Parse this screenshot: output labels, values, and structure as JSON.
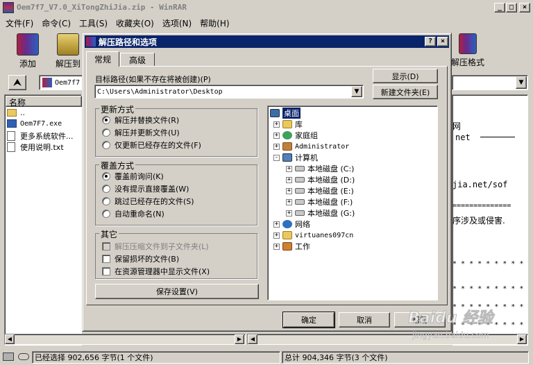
{
  "window": {
    "title": "Oem7f7_V7.0_XiTongZhiJia.zip - WinRAR",
    "min": "_",
    "max": "□",
    "close": "×"
  },
  "menu": [
    "文件(F)",
    "命令(C)",
    "工具(S)",
    "收藏夹(O)",
    "选项(N)",
    "帮助(H)"
  ],
  "toolbar": {
    "add": "添加",
    "extract_to": "解压到",
    "extract_format": "解压格式"
  },
  "address": {
    "path": "Oem7f7"
  },
  "filelist": {
    "header_name": "名称",
    "items": [
      "..",
      "Oem7F7.exe",
      "更多系统软件...",
      "使用说明.txt"
    ]
  },
  "bg_text": {
    "lines": [
      "网",
      "net",
      "jia.net/sof",
      "==============",
      "序涉及或侵害.",
      "* * * * * * * * *",
      "* * * * * * * * *",
      "* * * * * * * * *",
      "* * * * * * * * *"
    ]
  },
  "dialog": {
    "title": "解压路径和选项",
    "help_btn": "?",
    "close_btn": "×",
    "tabs": [
      "常规",
      "高级"
    ],
    "dest_label": "目标路径(如果不存在将被创建)(P)",
    "dest_value": "C:\\Users\\Administrator\\Desktop",
    "show_btn": "显示(D)",
    "new_folder_btn": "新建文件夹(E)",
    "update_group": {
      "title": "更新方式",
      "options": [
        "解压并替换文件(R)",
        "解压并更新文件(U)",
        "仅更新已经存在的文件(F)"
      ],
      "selected": 0
    },
    "overwrite_group": {
      "title": "覆盖方式",
      "options": [
        "覆盖前询问(K)",
        "没有提示直接覆盖(W)",
        "跳过已经存在的文件(S)",
        "自动重命名(N)"
      ],
      "selected": 0
    },
    "misc_group": {
      "title": "其它",
      "options": [
        "解压压缩文件到子文件夹(L)",
        "保留损坏的文件(B)",
        "在资源管理器中显示文件(X)"
      ],
      "disabled_index": 0
    },
    "save_btn": "保存设置(V)",
    "tree": [
      {
        "label": "桌面",
        "level": 0,
        "expander": "",
        "selected": true
      },
      {
        "label": "库",
        "level": 1,
        "expander": "+"
      },
      {
        "label": "家庭组",
        "level": 1,
        "expander": "+"
      },
      {
        "label": "Administrator",
        "level": 1,
        "expander": "+"
      },
      {
        "label": "计算机",
        "level": 1,
        "expander": "-"
      },
      {
        "label": "本地磁盘 (C:)",
        "level": 2,
        "expander": "+"
      },
      {
        "label": "本地磁盘 (D:)",
        "level": 2,
        "expander": "+"
      },
      {
        "label": "本地磁盘 (E:)",
        "level": 2,
        "expander": "+"
      },
      {
        "label": "本地磁盘 (F:)",
        "level": 2,
        "expander": "+"
      },
      {
        "label": "本地磁盘 (G:)",
        "level": 2,
        "expander": "+"
      },
      {
        "label": "网络",
        "level": 1,
        "expander": "+"
      },
      {
        "label": "virtuanes097cn",
        "level": 1,
        "expander": "+"
      },
      {
        "label": "工作",
        "level": 1,
        "expander": "+"
      }
    ],
    "ok_btn": "确定",
    "cancel_btn": "取消",
    "help_label": "帮助"
  },
  "status": {
    "left": "已经选择 902,656 字节(1 个文件)",
    "right": "总计 904,346 字节(3 个文件)"
  },
  "watermark": {
    "brand": "Baidu 经验",
    "url": "jingyan.baidu.com"
  },
  "colors": {
    "title_bg": "#0a246a",
    "selected": "#0a246a",
    "face": "#d4d0c8"
  }
}
